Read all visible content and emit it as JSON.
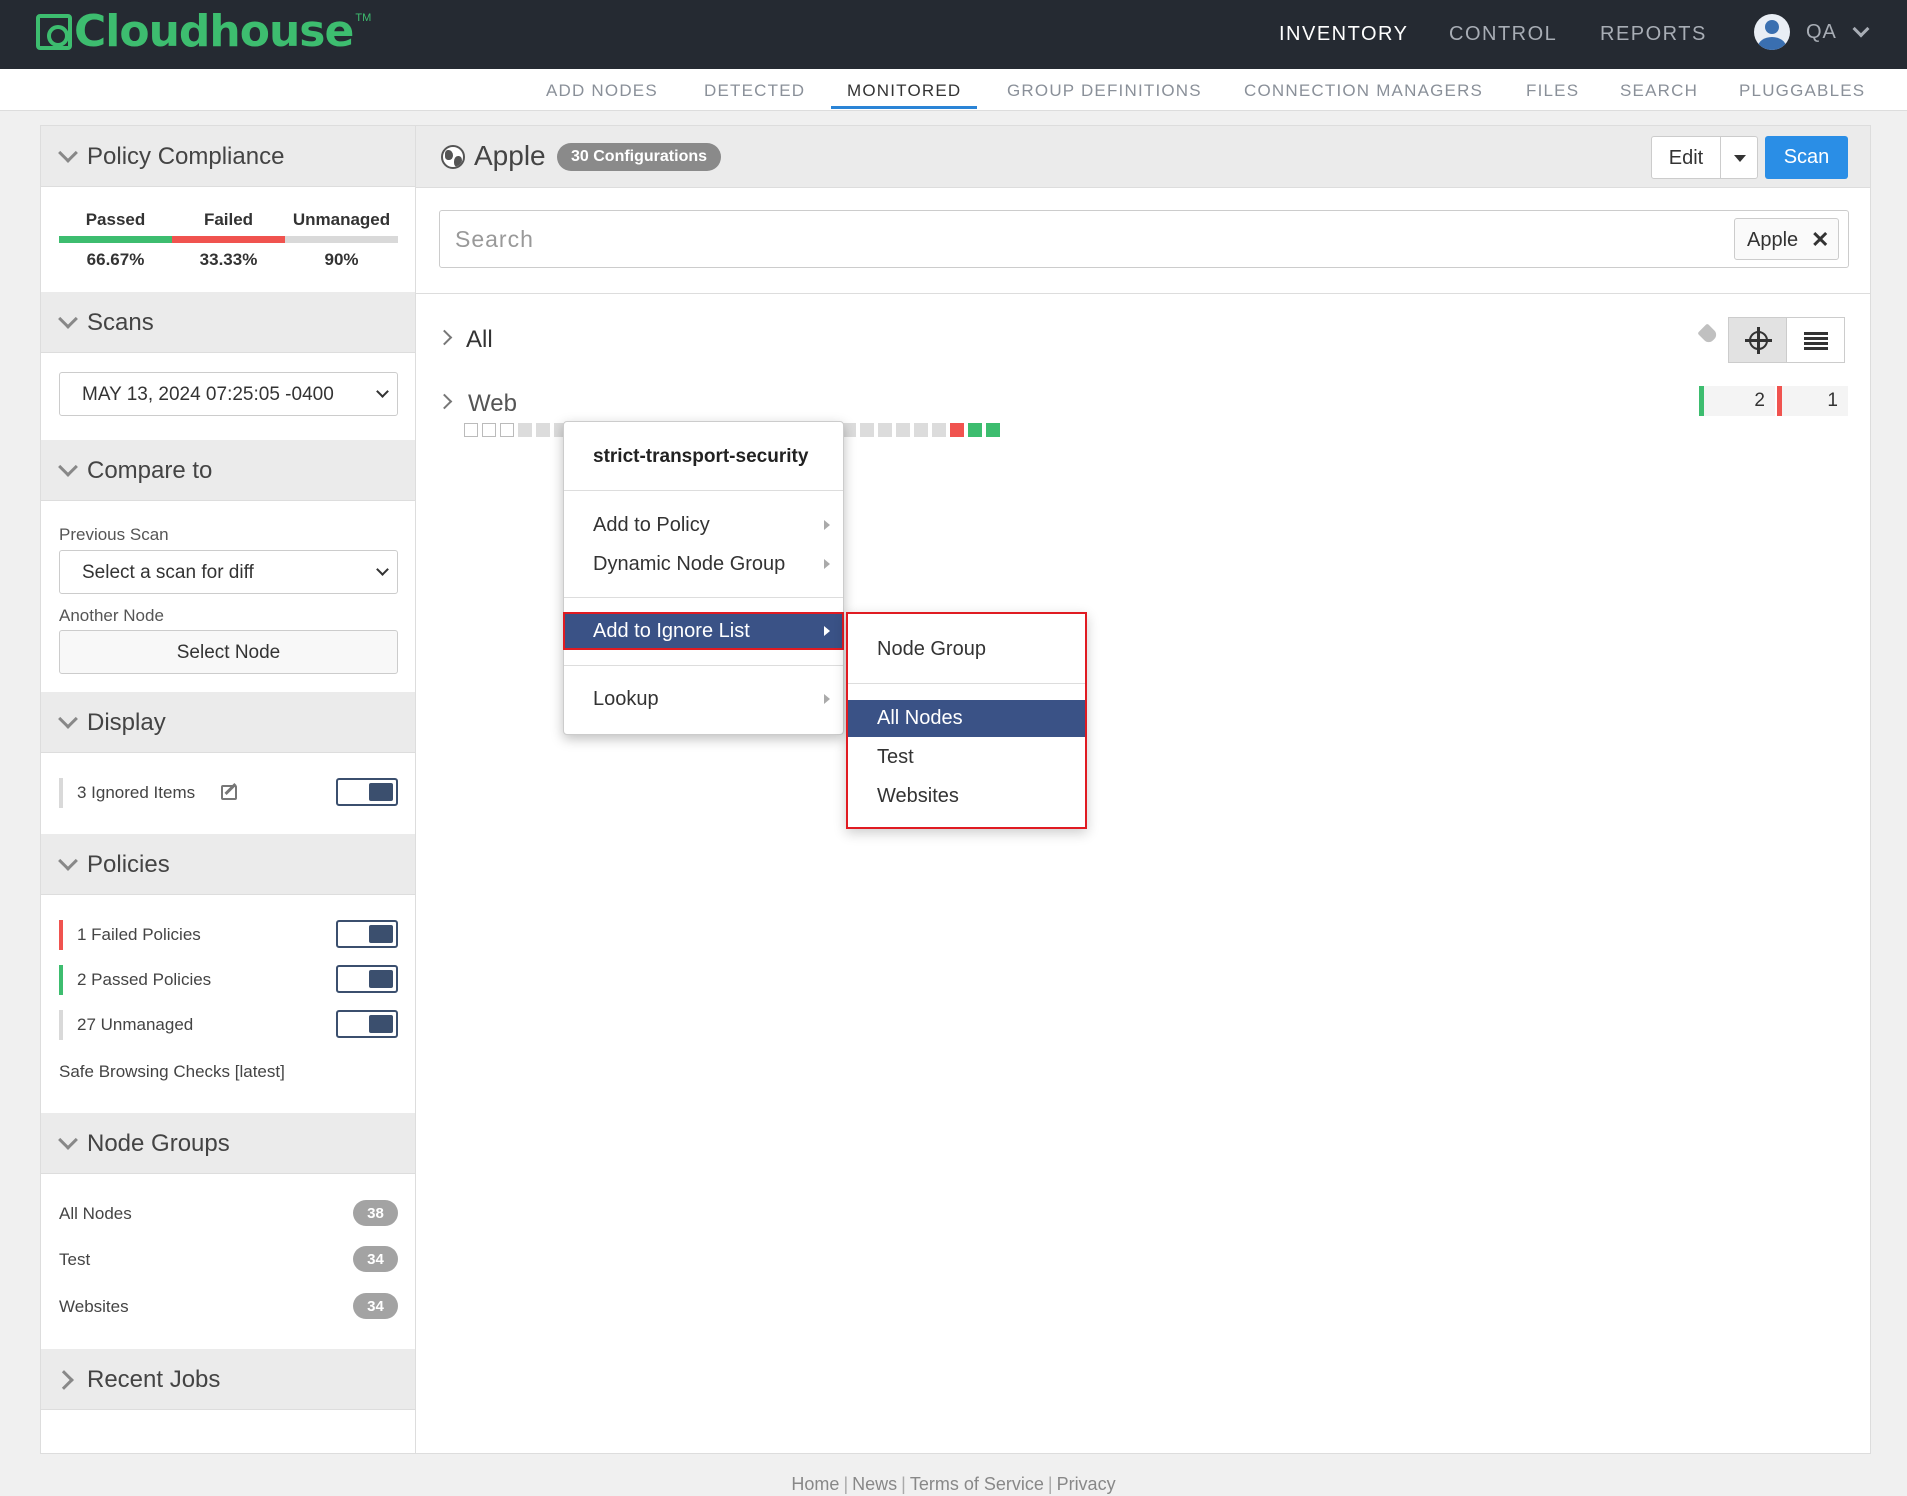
{
  "brand": {
    "name": "Cloudhouse",
    "tm": "TM",
    "accent": "#3dbd6f"
  },
  "topnav": [
    {
      "label": "INVENTORY",
      "active": true
    },
    {
      "label": "CONTROL",
      "active": false
    },
    {
      "label": "REPORTS",
      "active": false
    }
  ],
  "user": {
    "name": "QA"
  },
  "subnav": [
    "ADD NODES",
    "DETECTED",
    "MONITORED",
    "GROUP DEFINITIONS",
    "CONNECTION MANAGERS",
    "FILES",
    "SEARCH",
    "PLUGGABLES"
  ],
  "subnav_active": "MONITORED",
  "sidebar": {
    "policy_compliance": {
      "title": "Policy Compliance",
      "labels": [
        "Passed",
        "Failed",
        "Unmanaged"
      ],
      "values": [
        "66.67%",
        "33.33%",
        "90%"
      ],
      "colors": [
        "#3dbd6f",
        "#f0534f",
        "#d9d9d9"
      ]
    },
    "scans": {
      "title": "Scans",
      "selected": "MAY 13, 2024 07:25:05 -0400"
    },
    "compare": {
      "title": "Compare to",
      "previous_label": "Previous Scan",
      "previous_placeholder": "Select a scan for diff",
      "another_label": "Another Node",
      "select_node": "Select Node"
    },
    "display": {
      "title": "Display",
      "ignored": "3 Ignored Items",
      "ignored_on": true
    },
    "policies": {
      "title": "Policies",
      "items": [
        {
          "label": "1 Failed Policies",
          "color": "#f0534f",
          "on": true
        },
        {
          "label": "2 Passed Policies",
          "color": "#3dbd6f",
          "on": true
        },
        {
          "label": "27 Unmanaged",
          "color": "#d9d9d9",
          "on": true
        }
      ],
      "footer": "Safe Browsing Checks [latest]"
    },
    "node_groups": {
      "title": "Node Groups",
      "items": [
        {
          "label": "All Nodes",
          "count": "38"
        },
        {
          "label": "Test",
          "count": "34"
        },
        {
          "label": "Websites",
          "count": "34"
        }
      ]
    },
    "recent_jobs": {
      "title": "Recent Jobs"
    }
  },
  "main": {
    "title": "Apple",
    "config_badge": "30 Configurations",
    "edit_label": "Edit",
    "scan_label": "Scan",
    "search_placeholder": "Search",
    "search_tag": "Apple",
    "tree": [
      {
        "label": "All"
      },
      {
        "label": "Web",
        "passed": "2",
        "failed": "1"
      }
    ]
  },
  "context_menu": {
    "title": "strict-transport-security",
    "items": [
      "Add to Policy",
      "Dynamic Node Group",
      "Add to Ignore List",
      "Lookup"
    ],
    "selected": "Add to Ignore List",
    "submenu": {
      "title": "Node Group",
      "items": [
        "All Nodes",
        "Test",
        "Websites"
      ],
      "selected": "All Nodes"
    }
  },
  "footer": [
    "Home",
    "News",
    "Terms of Service",
    "Privacy"
  ]
}
